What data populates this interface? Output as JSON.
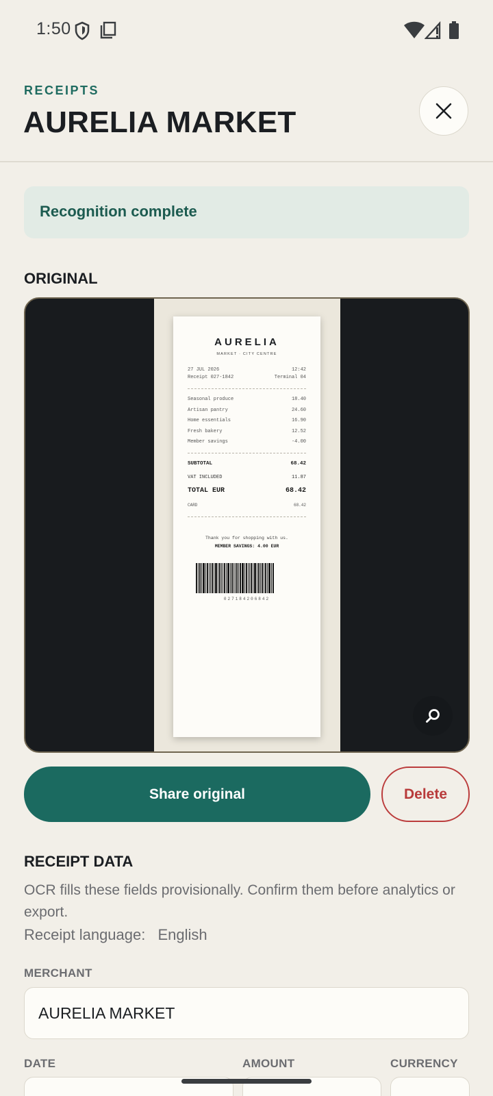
{
  "status_bar": {
    "time": "1:50",
    "icons": [
      "shield-icon",
      "copy-icon",
      "wifi-icon",
      "signal-icon",
      "battery-icon"
    ]
  },
  "header": {
    "eyebrow": "RECEIPTS",
    "title": "AURELIA MARKET",
    "close_icon": "close-icon"
  },
  "banner": {
    "text": "Recognition complete"
  },
  "original": {
    "label": "ORIGINAL",
    "zoom_icon": "search-icon",
    "receipt": {
      "brand": "AURELIA",
      "subtitle": "MARKET · CITY CENTRE",
      "date": "27 JUL 2026",
      "time": "12:42",
      "receipt_no": "Receipt 027-1842",
      "terminal": "Terminal 04",
      "items": [
        {
          "name": "Seasonal produce",
          "price": "18.40"
        },
        {
          "name": "Artisan pantry",
          "price": "24.60"
        },
        {
          "name": "Home essentials",
          "price": "16.90"
        },
        {
          "name": "Fresh bakery",
          "price": "12.52"
        },
        {
          "name": "Member savings",
          "price": "-4.00"
        }
      ],
      "subtotal_label": "SUBTOTAL",
      "subtotal": "68.42",
      "vat_label": "VAT INCLUDED",
      "vat": "11.87",
      "total_label": "TOTAL EUR",
      "total": "68.42",
      "payment_label": "CARD",
      "payment": "68.42",
      "thanks": "Thank you for shopping with us.",
      "savings_note": "MEMBER SAVINGS: 4.00 EUR",
      "barcode_number": "027184206842"
    }
  },
  "actions": {
    "share_label": "Share original",
    "delete_label": "Delete"
  },
  "receipt_data": {
    "label": "RECEIPT DATA",
    "helper": "OCR fills these fields provisionally. Confirm them before analytics or export.",
    "language_label": "Receipt language:",
    "language_value": "English",
    "merchant_label": "MERCHANT",
    "merchant_value": "AURELIA MARKET",
    "date_label": "DATE",
    "amount_label": "AMOUNT",
    "currency_label": "CURRENCY"
  },
  "colors": {
    "background": "#f2efe8",
    "accent": "#1b6a60",
    "danger": "#b83a3a",
    "banner_bg": "#e2ebe5"
  }
}
